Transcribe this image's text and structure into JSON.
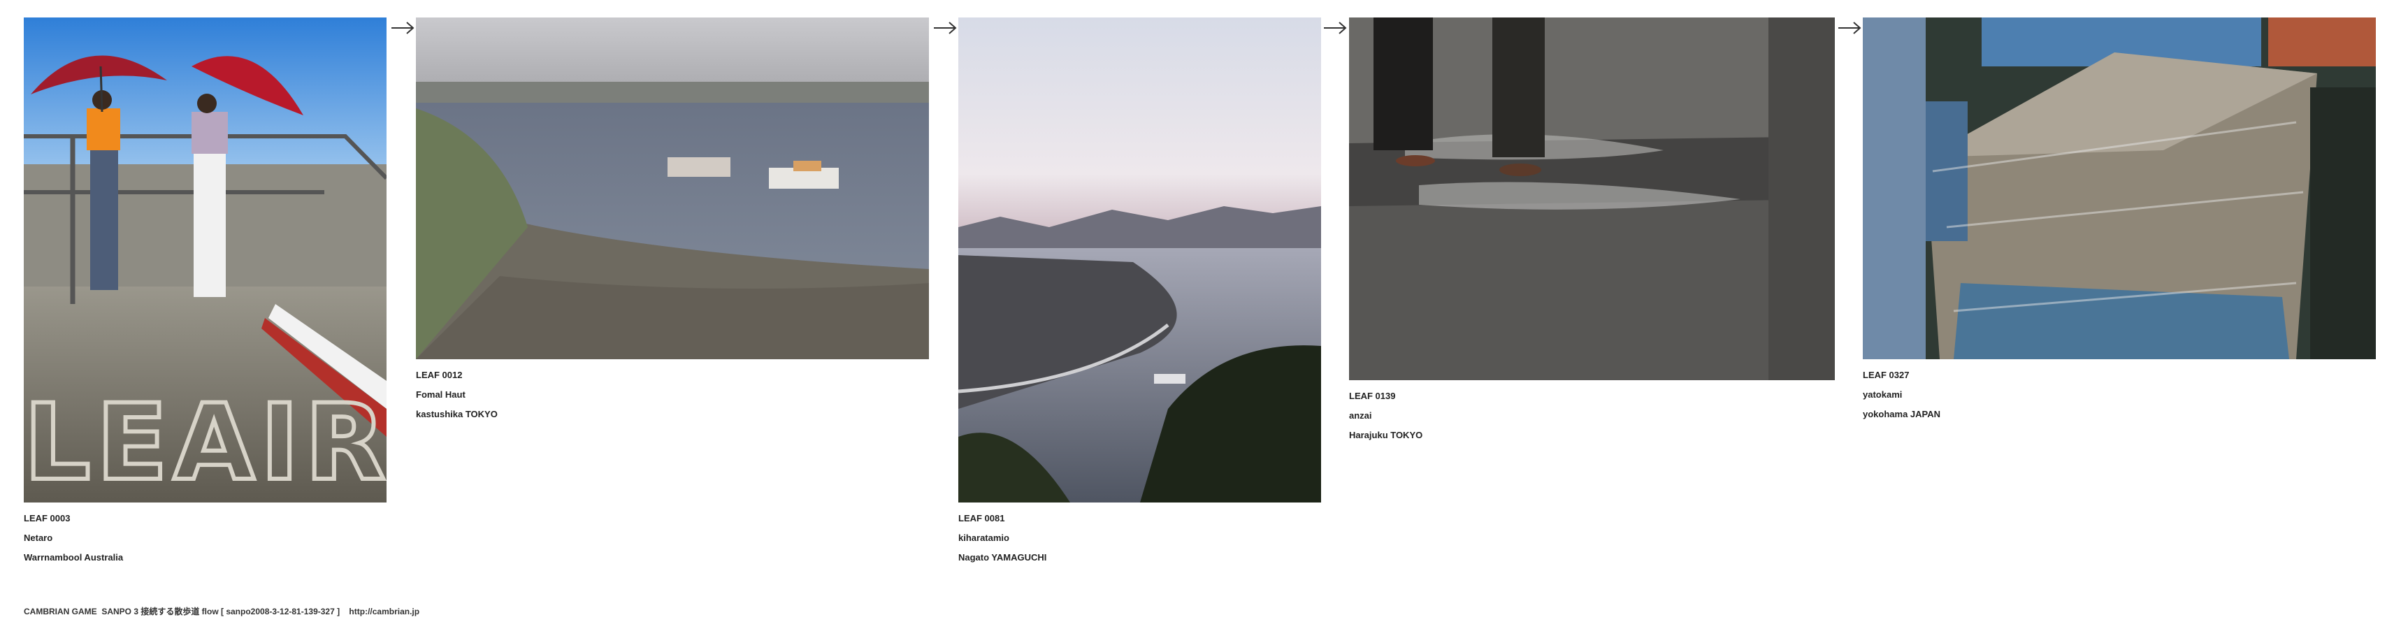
{
  "leaves": [
    {
      "id": "LEAF 0003",
      "author": "Netaro",
      "place": "Warrnambool Australia"
    },
    {
      "id": "LEAF 0012",
      "author": "Fomal Haut",
      "place": "kastushika TOKYO"
    },
    {
      "id": "LEAF 0081",
      "author": "kiharatamio",
      "place": "Nagato YAMAGUCHI"
    },
    {
      "id": "LEAF 0139",
      "author": "anzai",
      "place": "Harajuku TOKYO"
    },
    {
      "id": "LEAF 0327",
      "author": "yatokami",
      "place": "yokohama  JAPAN"
    }
  ],
  "leaf0_wall_text": "LEAIR",
  "arrows": [
    "→",
    "→",
    "→",
    "→"
  ],
  "footer": {
    "text": "CAMBRIAN GAME  SANPO 3 接続する散歩道 flow [ sanpo2008-3-12-81-139-327 ]    http://cambrian.jp"
  },
  "colors": {
    "background": "#ffffff",
    "text": "#222222"
  }
}
